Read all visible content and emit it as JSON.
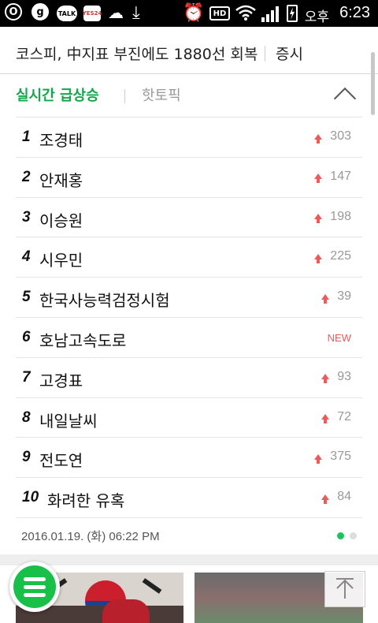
{
  "status_bar": {
    "ampm": "오후",
    "time": "6:23",
    "icons": [
      "o-icon",
      "g-icon",
      "talk-icon",
      "yes24-icon",
      "cloud-icon",
      "download-icon",
      "alarm-icon",
      "hd-icon",
      "wifi-icon",
      "signal-icon",
      "battery-charging-icon"
    ],
    "talk_label": "TALK",
    "yes24_label": "YES24",
    "hd_label": "HD"
  },
  "headline": {
    "text": "코스피, 中지표 부진에도 1880선 회복",
    "category": "증시"
  },
  "tabs": [
    {
      "label": "실시간 급상승",
      "active": true
    },
    {
      "label": "핫토픽",
      "active": false
    }
  ],
  "ranking": [
    {
      "rank": "1",
      "keyword": "조경태",
      "change": "303",
      "trend": "up"
    },
    {
      "rank": "2",
      "keyword": "안재홍",
      "change": "147",
      "trend": "up"
    },
    {
      "rank": "3",
      "keyword": "이승원",
      "change": "198",
      "trend": "up"
    },
    {
      "rank": "4",
      "keyword": "시우민",
      "change": "225",
      "trend": "up"
    },
    {
      "rank": "5",
      "keyword": "한국사능력검정시험",
      "change": "39",
      "trend": "up"
    },
    {
      "rank": "6",
      "keyword": "호남고속도로",
      "change": "NEW",
      "trend": "new"
    },
    {
      "rank": "7",
      "keyword": "고경표",
      "change": "93",
      "trend": "up"
    },
    {
      "rank": "8",
      "keyword": "내일날씨",
      "change": "72",
      "trend": "up"
    },
    {
      "rank": "9",
      "keyword": "전도연",
      "change": "375",
      "trend": "up"
    },
    {
      "rank": "10",
      "keyword": "화려한 유혹",
      "change": "84",
      "trend": "up"
    }
  ],
  "timestamp": "2016.01.19. (화) 06:22 PM",
  "pagination": {
    "total": 2,
    "current": 1
  },
  "colors": {
    "accent_green": "#11a84b",
    "up_red": "#ec5a5a",
    "fab_green": "#18c04a"
  }
}
